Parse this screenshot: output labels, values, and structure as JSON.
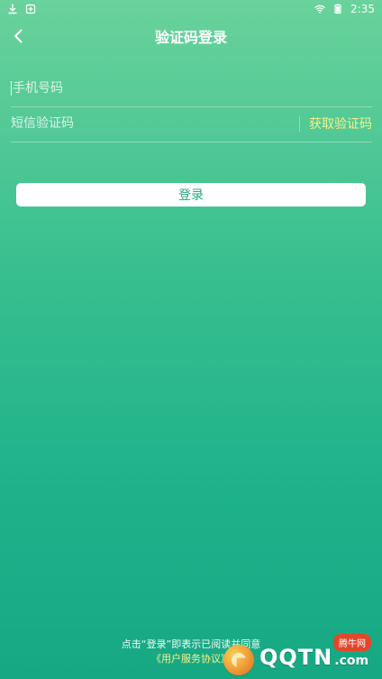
{
  "status_bar": {
    "time": "2:35",
    "icons": [
      "download-icon",
      "notification-icon",
      "wifi-icon",
      "battery-icon"
    ]
  },
  "header": {
    "title": "验证码登录",
    "back_icon": "chevron-left-icon"
  },
  "form": {
    "phone_placeholder": "手机号码",
    "sms_placeholder": "短信验证码",
    "get_code_label": "获取验证码",
    "login_label": "登录"
  },
  "footer": {
    "agreement_text": "点击“登录”即表示已阅读并同意",
    "agreement_link": "《用户服务协议》"
  },
  "watermark": {
    "badge": "腾牛网",
    "brand": "QQTN",
    "dotcom": ".com"
  },
  "colors": {
    "accent_yellow": "#f6f18b",
    "primary_green": "#23a87c"
  }
}
